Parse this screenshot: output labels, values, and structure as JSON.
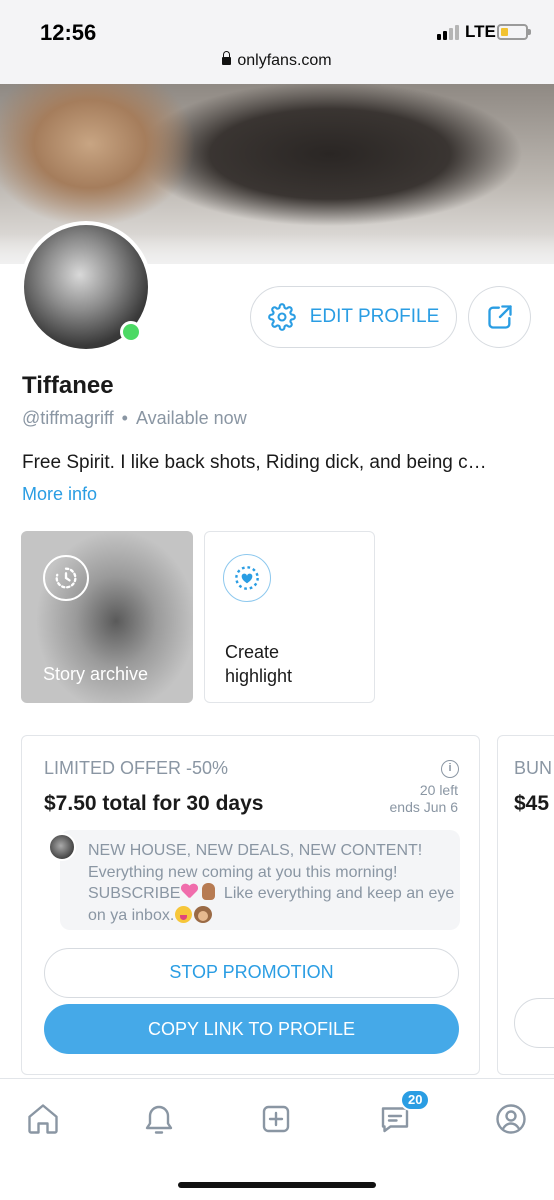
{
  "status_bar": {
    "time": "12:56",
    "network": "LTE",
    "url": "onlyfans.com"
  },
  "profile": {
    "name": "Tiffanee",
    "handle": "@tiffmagriff",
    "status_separator": "•",
    "availability": "Available now",
    "bio": "Free Spirit. I like back shots, Riding dick, and being c…",
    "more_info": "More info",
    "online": true,
    "edit_profile_label": "EDIT PROFILE"
  },
  "highlights": {
    "story_archive_label": "Story archive",
    "create_highlight_line1": "Create",
    "create_highlight_line2": "highlight"
  },
  "offer": {
    "title": "LIMITED OFFER -50%",
    "price": "$7.50 total for 30 days",
    "remaining": "20 left",
    "ends": "ends Jun 6",
    "message_part1": "NEW HOUSE, NEW DEALS, NEW CONTENT! Everything new coming at you this morning! SUBSCRIBE",
    "message_part2": "Like everything and keep an eye on ya inbox.",
    "stop_label": "STOP PROMOTION",
    "copy_label": "COPY LINK TO PROFILE"
  },
  "offer2": {
    "title": "BUN",
    "price": "$45"
  },
  "bottom_nav": {
    "items": [
      "home-icon",
      "bell-icon",
      "plus-square-icon",
      "messages-icon",
      "profile-icon"
    ],
    "messages_badge": "20"
  },
  "colors": {
    "accent": "#2a9de3",
    "button_fill": "#45a9e8",
    "muted_text": "#8a96a3",
    "online": "#4cd964"
  }
}
